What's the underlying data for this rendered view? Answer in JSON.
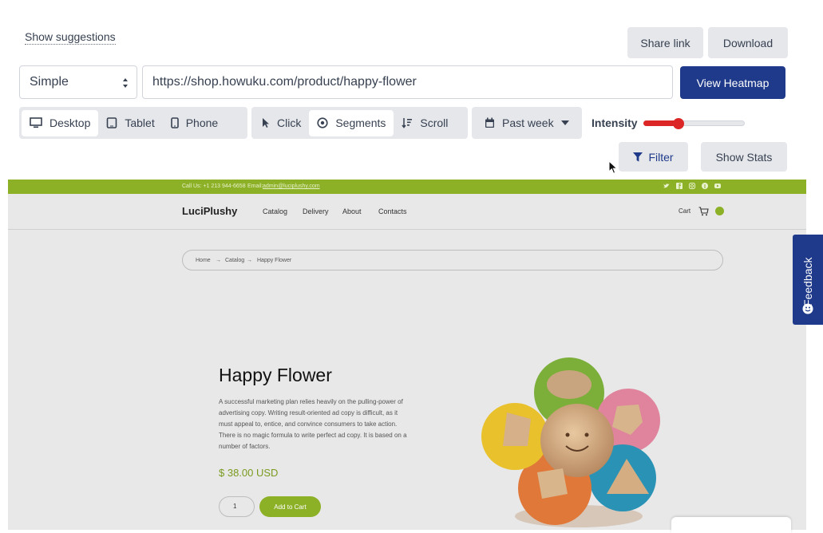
{
  "toolbar": {
    "suggestions_link": "Show suggestions",
    "share_label": "Share link",
    "download_label": "Download",
    "mode_select": "Simple",
    "url_value": "https://shop.howuku.com/product/happy-flower",
    "view_heatmap_label": "View Heatmap",
    "devices": [
      {
        "label": "Desktop",
        "icon": "desktop-icon",
        "active": true
      },
      {
        "label": "Tablet",
        "icon": "tablet-icon",
        "active": false
      },
      {
        "label": "Phone",
        "icon": "phone-icon",
        "active": false
      }
    ],
    "modes": [
      {
        "label": "Click",
        "icon": "pointer-icon",
        "active": false
      },
      {
        "label": "Segments",
        "icon": "target-icon",
        "active": true
      },
      {
        "label": "Scroll",
        "icon": "sort-icon",
        "active": false
      }
    ],
    "date_range": "Past week",
    "intensity_label": "Intensity",
    "intensity_level": 0.35,
    "filter_label": "Filter",
    "stats_label": "Show Stats"
  },
  "preview": {
    "topbar": {
      "phone": "Call Us: +1 213 944-6658",
      "email_prefix": "Email:",
      "email": "admin@luciplushy.com"
    },
    "logo": "LuciPlushy",
    "nav": [
      "Catalog",
      "Delivery",
      "About",
      "Contacts"
    ],
    "cart": "Cart",
    "breadcrumb": [
      "Home",
      "Catalog",
      "Happy Flower"
    ],
    "product": {
      "title": "Happy Flower",
      "description": "A successful marketing plan relies heavily on the pulling-power of advertising copy. Writing result-oriented ad copy is difficult, as it must appeal to, entice, and convince consumers to take action. There is no magic formula to write perfect ad copy. It is based on a number of factors.",
      "price": "$ 38.00 USD",
      "quantity": "1",
      "add_to_cart": "Add to Cart"
    }
  },
  "feedback_tab": "Feedback",
  "colors": {
    "primary": "#1f3a8a",
    "accent_green": "#8cb026",
    "slider_red": "#dc2626"
  }
}
